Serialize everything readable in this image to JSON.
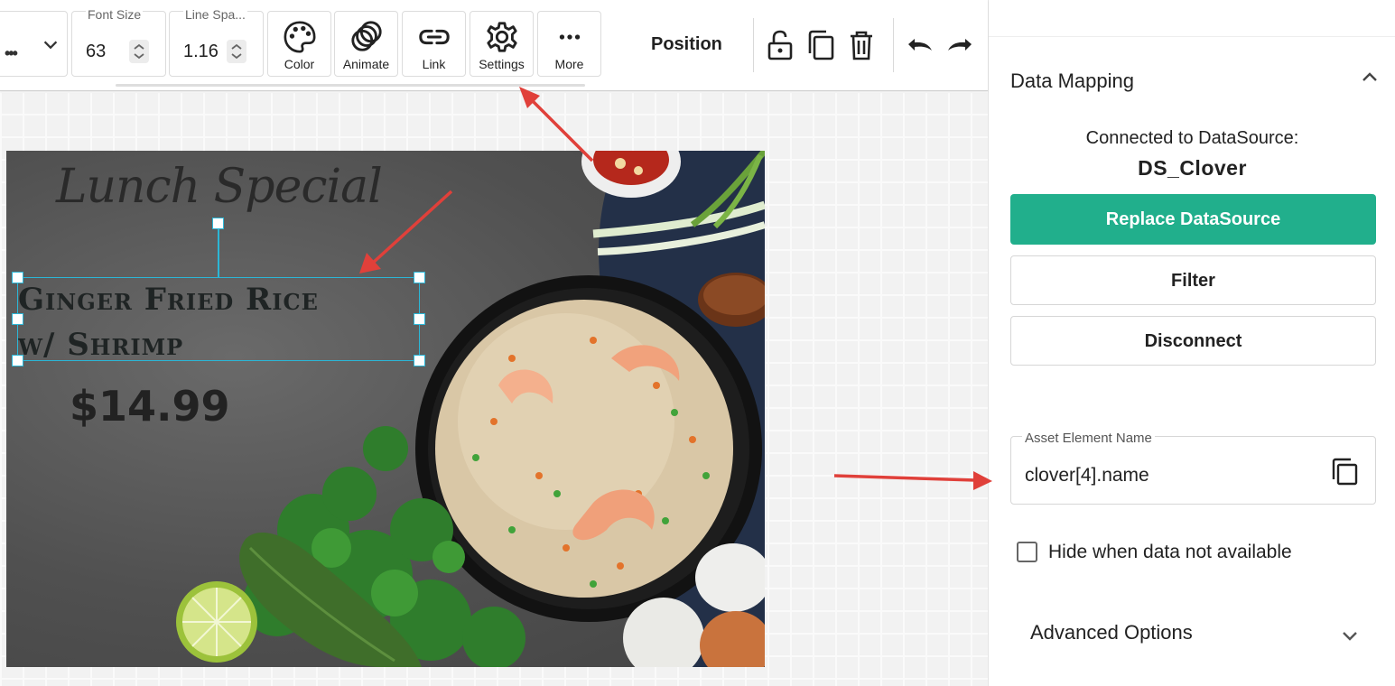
{
  "toolbar": {
    "font_size_label": "Font Size",
    "font_size_value": "63",
    "line_spacing_label": "Line Spa...",
    "line_spacing_value": "1.16",
    "color_label": "Color",
    "animate_label": "Animate",
    "link_label": "Link",
    "settings_label": "Settings",
    "more_label": "More",
    "position_label": "Position",
    "icons": [
      "chevron-down-icon",
      "palette-icon",
      "animate-rings-icon",
      "link-icon",
      "gear-icon",
      "more-dots-icon",
      "unlock-icon",
      "duplicate-icon",
      "trash-icon",
      "undo-icon",
      "redo-icon"
    ]
  },
  "canvas": {
    "title_script": "Lunch Special",
    "dish_line1": "Ginger Fried Rice",
    "dish_line2": "w/ Shrimp",
    "price": "$14.99"
  },
  "panel": {
    "section_title": "Data Mapping",
    "connected_label": "Connected to DataSource:",
    "datasource_name": "DS_Clover",
    "replace_button": "Replace DataSource",
    "filter_button": "Filter",
    "disconnect_button": "Disconnect",
    "asset_field_label": "Asset Element Name",
    "asset_field_value": "clover[4].name",
    "hide_checkbox_label": "Hide when data not available",
    "hide_checkbox_checked": false,
    "advanced_label": "Advanced Options"
  },
  "colors": {
    "primary": "#21af8c",
    "selection": "#2bb6d6",
    "annotation_arrow": "#e0403a"
  }
}
